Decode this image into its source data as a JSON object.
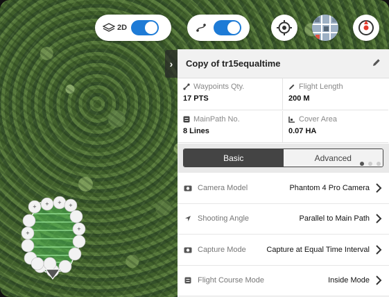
{
  "map": {
    "mode_label": "2D"
  },
  "panel": {
    "collapse_glyph": "›",
    "title": "Copy of tr15equaltime",
    "stats": [
      {
        "label": "Waypoints Qty.",
        "value": "17 PTS",
        "icon": "waypoints-icon"
      },
      {
        "label": "Flight Length",
        "value": "200 M",
        "icon": "ruler-icon"
      },
      {
        "label": "MainPath No.",
        "value": "8 Lines",
        "icon": "path-icon"
      },
      {
        "label": "Cover Area",
        "value": "0.07 HA",
        "icon": "area-icon"
      }
    ],
    "page_dots": 3,
    "active_page": 0,
    "tabs": [
      {
        "label": "Basic",
        "active": true
      },
      {
        "label": "Advanced",
        "active": false
      }
    ],
    "settings": [
      {
        "label": "Camera Model",
        "value": "Phantom 4 Pro Camera",
        "icon": "camera-icon"
      },
      {
        "label": "Shooting Angle",
        "value": "Parallel to Main Path",
        "icon": "direction-arrow-icon"
      },
      {
        "label": "Capture Mode",
        "value": "Capture at Equal Time Interval",
        "icon": "capture-icon"
      },
      {
        "label": "Flight Course Mode",
        "value": "Inside Mode",
        "icon": "course-icon"
      }
    ]
  },
  "colors": {
    "toggle_on": "#1e7bd6",
    "tab_active": "#444444",
    "panel_bg": "#f3f3f3"
  }
}
